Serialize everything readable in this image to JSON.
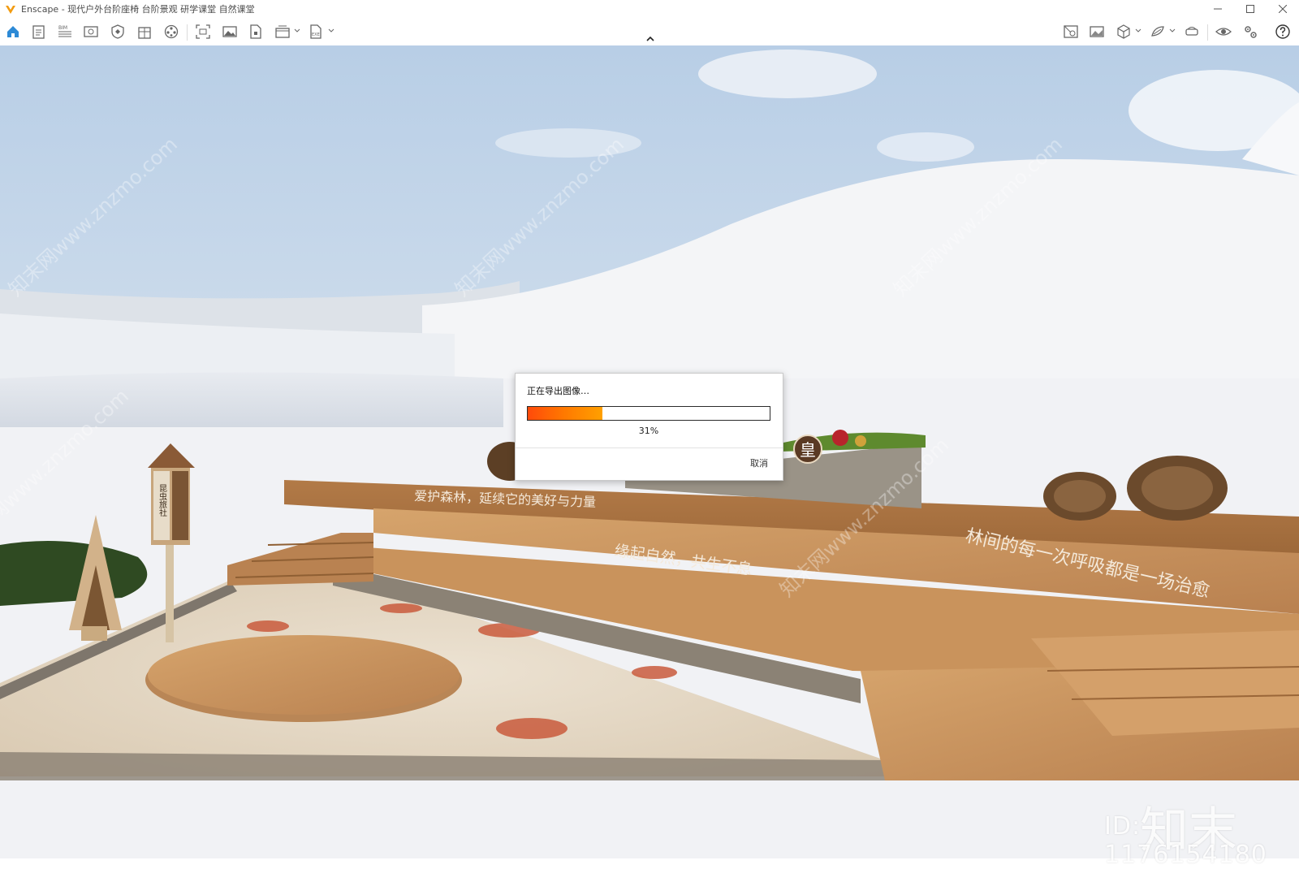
{
  "window": {
    "title": "Enscape - 现代户外台阶座椅 台阶景观 研学课堂 自然课堂",
    "accent_color": "#f29b10"
  },
  "toolbar": {
    "left_icons": [
      "home-icon",
      "document-icon",
      "bim-icon",
      "view-icon",
      "shield-icon",
      "building-icon",
      "film-icon",
      "screenshot-icon",
      "image-icon",
      "pdf-icon",
      "batch-render-icon",
      "exe-export-icon"
    ],
    "bim_label": "BIM",
    "exe_label": "EXE",
    "right_icons": [
      "asset-library-icon",
      "gallery-icon",
      "cube-icon",
      "material-icon",
      "vr-headset-icon",
      "eye-icon",
      "settings-icon",
      "help-icon"
    ]
  },
  "scene": {
    "sign_text_1": "爱护森林，延续它的美好与力量",
    "sign_text_2": "缘起自然，共生不息",
    "sign_text_3": "林间的每一次呼吸都是一场治愈",
    "insect_hotel_label": "昆虫旅社",
    "badge_char": "皇",
    "sky_color": "#cfdceb",
    "snow_color": "#f3f4f6",
    "wood_color": "#c9925a"
  },
  "watermarks": {
    "brand": "知末",
    "id_text": "ID: 1176154180",
    "diagonal": "知末网www.znzmo.com"
  },
  "dialog": {
    "title": "正在导出图像…",
    "progress": 0.31,
    "progress_label": "31%",
    "cancel_label": "取消",
    "progress_color": "#ff6a00"
  }
}
